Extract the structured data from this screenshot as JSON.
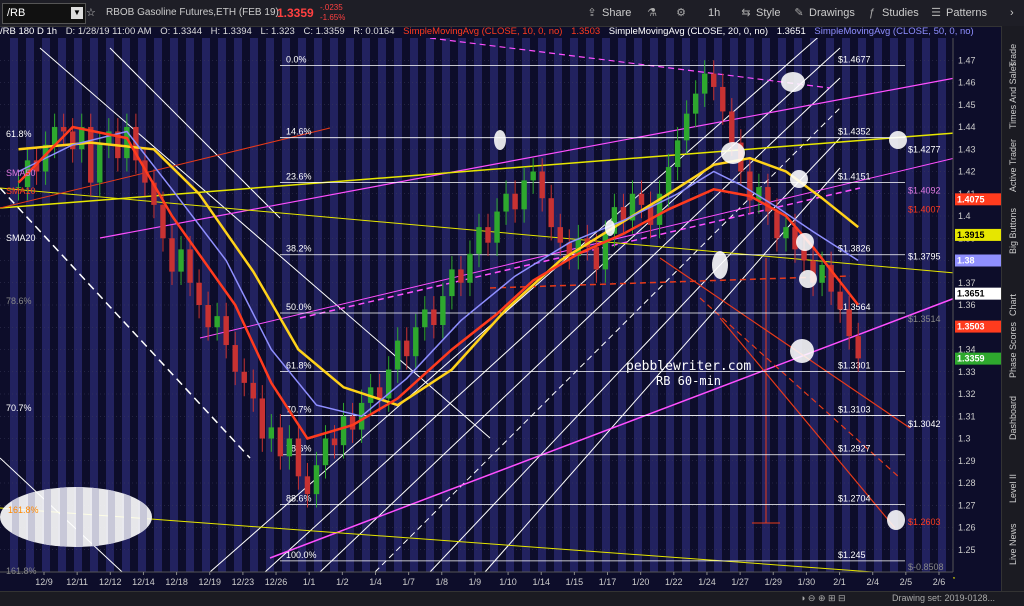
{
  "toolbar": {
    "symbol": "/RB",
    "instrument": "RBOB Gasoline Futures,ETH (FEB 19)",
    "last_price": "1.3359",
    "change": "-.0235",
    "change_pct": "-1.65%",
    "share": "Share",
    "interval": "1h",
    "style": "Style",
    "drawings": "Drawings",
    "studies": "Studies",
    "patterns": "Patterns"
  },
  "legend": {
    "title": "/RB 180 D 1h",
    "date": "D: 1/28/19 11:00 AM",
    "open": "O: 1.3344",
    "high": "H: 1.3394",
    "low": "L: 1.323",
    "close": "C: 1.3359",
    "r": "R: 0.0164",
    "sma10": "SimpleMovingAvg (CLOSE, 10, 0, no)",
    "sma10_val": "1.3503",
    "sma20": "SimpleMovingAvg (CLOSE, 20, 0, no)",
    "sma20_val": "1.3651",
    "sma50": "SimpleMovingAvg (CLOSE, 50, 0, no)"
  },
  "chart_labels": {
    "sma50": "SMA50",
    "sma10": "SMA10",
    "sma20": "SMA20",
    "fib_left_61": "61.8%",
    "fib_left_78": "78.6%",
    "fib_left_70": "70.7%",
    "fib_left_161": "161.8%",
    "fib_left_161b": "161.8%",
    "watermark_1": "pebblewriter.com",
    "watermark_2": "RB 60-min"
  },
  "colors": {
    "background": "#0d0d2a",
    "bands": "#34348a",
    "sma10": "#ff3b1e",
    "sma20": "#8f8fff",
    "sma50": "#ffd21a",
    "channel": "#ff4fff",
    "white_lines": "#ffffff",
    "yellow_lines": "#e6e600",
    "red_lines": "#e63a1a",
    "up_candle": "#2ea82e",
    "down_candle": "#c83232"
  },
  "chart_data": {
    "type": "candlestick",
    "title": "/RB 180 D 1h",
    "x_ticks": [
      "12/9",
      "12/11",
      "12/12",
      "12/14",
      "12/18",
      "12/19",
      "12/23",
      "12/26",
      "1/1",
      "1/2",
      "1/4",
      "1/7",
      "1/8",
      "1/9",
      "1/10",
      "1/14",
      "1/15",
      "1/17",
      "1/20",
      "1/22",
      "1/24",
      "1/27",
      "1/29",
      "1/30",
      "2/1",
      "2/4",
      "2/5",
      "2/6"
    ],
    "y_ticks": [
      1.25,
      1.26,
      1.27,
      1.28,
      1.29,
      1.3,
      1.31,
      1.32,
      1.33,
      1.34,
      1.35,
      1.36,
      1.37,
      1.38,
      1.39,
      1.4,
      1.41,
      1.42,
      1.43,
      1.44,
      1.45,
      1.46,
      1.47
    ],
    "ylim": [
      1.24,
      1.48
    ],
    "closes": [
      1.413,
      1.425,
      1.42,
      1.432,
      1.44,
      1.438,
      1.43,
      1.44,
      1.415,
      1.432,
      1.438,
      1.426,
      1.44,
      1.425,
      1.415,
      1.405,
      1.39,
      1.375,
      1.385,
      1.37,
      1.36,
      1.35,
      1.355,
      1.342,
      1.33,
      1.325,
      1.318,
      1.3,
      1.305,
      1.292,
      1.3,
      1.283,
      1.275,
      1.288,
      1.3,
      1.297,
      1.31,
      1.304,
      1.316,
      1.323,
      1.318,
      1.331,
      1.344,
      1.337,
      1.35,
      1.358,
      1.351,
      1.364,
      1.376,
      1.37,
      1.383,
      1.395,
      1.388,
      1.402,
      1.41,
      1.403,
      1.416,
      1.42,
      1.408,
      1.395,
      1.388,
      1.382,
      1.39,
      1.386,
      1.376,
      1.392,
      1.404,
      1.398,
      1.41,
      1.405,
      1.396,
      1.41,
      1.422,
      1.434,
      1.446,
      1.455,
      1.464,
      1.458,
      1.447,
      1.433,
      1.42,
      1.407,
      1.413,
      1.402,
      1.39,
      1.395,
      1.385,
      1.38,
      1.37,
      1.378,
      1.366,
      1.358,
      1.346,
      1.336
    ],
    "sma10_path": [
      [
        0,
        1.415
      ],
      [
        6,
        1.44
      ],
      [
        12,
        1.435
      ],
      [
        17,
        1.4
      ],
      [
        24,
        1.36
      ],
      [
        28,
        1.325
      ],
      [
        32,
        1.3
      ],
      [
        37,
        1.306
      ],
      [
        42,
        1.318
      ],
      [
        48,
        1.34
      ],
      [
        53,
        1.356
      ],
      [
        57,
        1.371
      ],
      [
        62,
        1.383
      ],
      [
        67,
        1.392
      ],
      [
        72,
        1.403
      ],
      [
        77,
        1.412
      ],
      [
        81,
        1.409
      ],
      [
        85,
        1.4
      ],
      [
        88,
        1.386
      ],
      [
        93,
        1.36
      ]
    ],
    "sma20_path": [
      [
        0,
        1.42
      ],
      [
        6,
        1.432
      ],
      [
        12,
        1.438
      ],
      [
        17,
        1.412
      ],
      [
        23,
        1.38
      ],
      [
        28,
        1.34
      ],
      [
        33,
        1.315
      ],
      [
        38,
        1.31
      ],
      [
        43,
        1.327
      ],
      [
        49,
        1.353
      ],
      [
        55,
        1.373
      ],
      [
        61,
        1.388
      ],
      [
        67,
        1.398
      ],
      [
        73,
        1.41
      ],
      [
        77,
        1.42
      ],
      [
        80,
        1.414
      ],
      [
        84,
        1.404
      ],
      [
        88,
        1.393
      ],
      [
        93,
        1.38
      ]
    ],
    "sma50_path": [
      [
        0,
        1.43
      ],
      [
        8,
        1.433
      ],
      [
        15,
        1.43
      ],
      [
        20,
        1.41
      ],
      [
        26,
        1.375
      ],
      [
        31,
        1.34
      ],
      [
        36,
        1.323
      ],
      [
        42,
        1.315
      ],
      [
        48,
        1.331
      ],
      [
        54,
        1.358
      ],
      [
        60,
        1.38
      ],
      [
        66,
        1.395
      ],
      [
        72,
        1.41
      ],
      [
        77,
        1.423
      ],
      [
        81,
        1.426
      ],
      [
        85,
        1.42
      ],
      [
        89,
        1.408
      ],
      [
        93,
        1.395
      ]
    ],
    "fib_levels": [
      {
        "label": "0.0%",
        "price": 1.4677,
        "price_label": "$1.4677"
      },
      {
        "label": "14.6%",
        "price": 1.4352,
        "price_label": "$1.4352"
      },
      {
        "label": "23.6%",
        "price": 1.4151,
        "price_label": "$1.4151"
      },
      {
        "label": "38.2%",
        "price": 1.3826,
        "price_label": "$1.3826"
      },
      {
        "label": "50.0%",
        "price": 1.3564,
        "price_label": "$1.3564"
      },
      {
        "label": "61.8%",
        "price": 1.3301,
        "price_label": "$1.3301"
      },
      {
        "label": "70.7%",
        "price": 1.3103,
        "price_label": "$1.3103"
      },
      {
        "label": "78.6%",
        "price": 1.2927,
        "price_label": "$1.2927"
      },
      {
        "label": "88.6%",
        "price": 1.2704,
        "price_label": "$1.2704"
      },
      {
        "label": "100.0%",
        "price": 1.245,
        "price_label": "$1.245"
      }
    ],
    "right_labels": [
      {
        "price": 1.4277,
        "text": "$1.4277",
        "color": "#ffffff"
      },
      {
        "price": 1.4092,
        "text": "$1.4092",
        "color": "#e07ae0"
      },
      {
        "price": 1.4007,
        "text": "$1.4007",
        "color": "#ff3b1e"
      },
      {
        "price": 1.3795,
        "text": "$1.3795",
        "color": "#ffffff"
      },
      {
        "price": 1.3514,
        "text": "$1.3514",
        "color": "#888888"
      },
      {
        "price": 1.3042,
        "text": "$1.3042",
        "color": "#ffffff"
      },
      {
        "price": 1.2603,
        "text": "$1.2603",
        "color": "#ff3b1e"
      },
      {
        "price": 1.24,
        "text": "$-0.8508",
        "color": "#888888"
      }
    ],
    "axis_badges": [
      {
        "price": 1.4075,
        "text": "1.4075",
        "bg": "#ff3b1e",
        "fg": "#ffffff"
      },
      {
        "price": 1.3915,
        "text": "1.3915",
        "bg": "#e6e600",
        "fg": "#000000"
      },
      {
        "price": 1.38,
        "text": "1.38",
        "bg": "#8f8fff",
        "fg": "#ffffff"
      },
      {
        "price": 1.3651,
        "text": "1.3651",
        "bg": "#ffffff",
        "fg": "#000000"
      },
      {
        "price": 1.3503,
        "text": "1.3503",
        "bg": "#ff3b1e",
        "fg": "#ffffff"
      },
      {
        "price": 1.3359,
        "text": "1.3359",
        "bg": "#2ea82e",
        "fg": "#ffffff"
      }
    ],
    "grid": true
  },
  "right_nav": [
    "Trade",
    "Times And Sales",
    "Active Trader",
    "Big Buttons",
    "Chart",
    "Phase Scores",
    "Dashboard",
    "Level II",
    "Live News"
  ],
  "status": {
    "drawing_set": "Drawing set: 2019-0128..."
  }
}
